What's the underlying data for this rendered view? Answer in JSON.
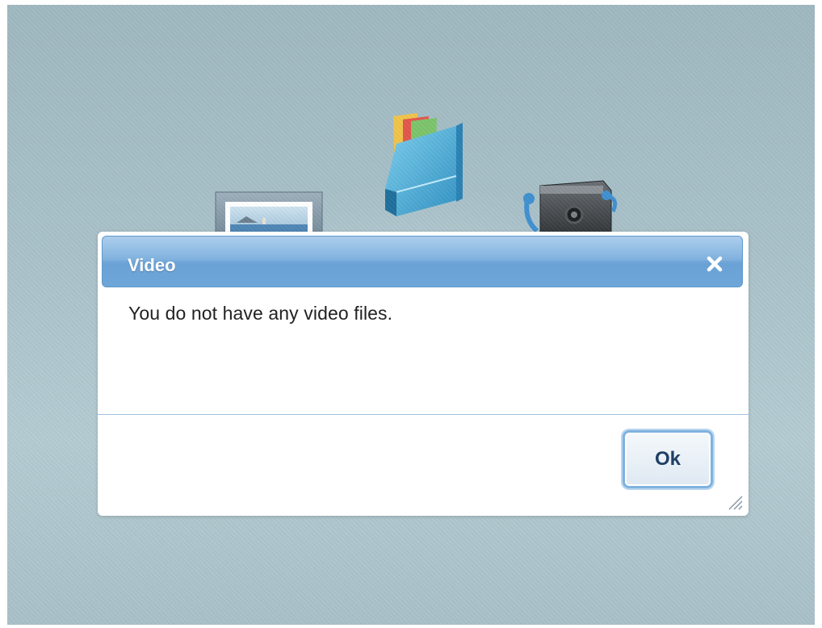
{
  "desktop": {
    "icons": [
      {
        "name": "photos-icon"
      },
      {
        "name": "documents-icon"
      },
      {
        "name": "music-icon"
      }
    ]
  },
  "dialog": {
    "title": "Video",
    "message": "You do not have any video files.",
    "ok_label": "Ok",
    "close_icon": "close-icon",
    "resize_icon": "resize-grip-icon"
  },
  "colors": {
    "titlebar": "#78acdc",
    "ok_text": "#1f3f66",
    "background": "#a9c1c9"
  }
}
